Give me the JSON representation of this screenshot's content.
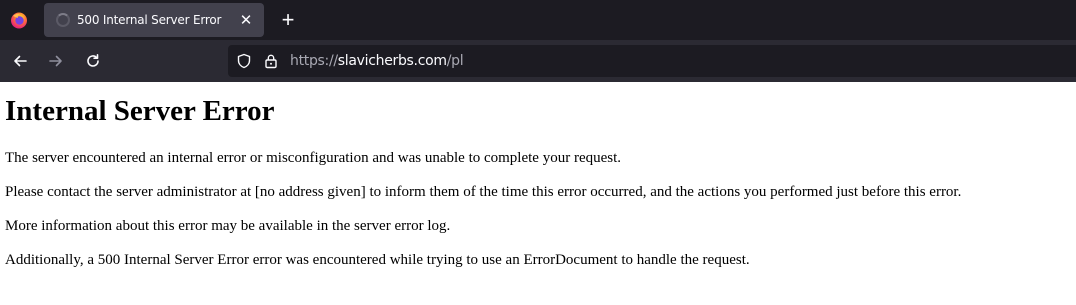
{
  "browser": {
    "tab": {
      "title": "500 Internal Server Error",
      "state": "loading"
    },
    "url": {
      "scheme": "https://",
      "host": "slavicherbs.com",
      "path": "/pl"
    },
    "icons": {
      "menu": "firefox-logo-icon",
      "close": "close-icon",
      "new_tab": "plus-icon",
      "back": "back-arrow-icon",
      "forward": "forward-arrow-icon",
      "reload": "reload-icon",
      "tracking": "shield-icon",
      "security": "lock-icon"
    },
    "colors": {
      "tabstrip": "#1c1b22",
      "active_tab": "#42414d",
      "toolbar": "#2b2a33",
      "urlbar": "#1c1b22"
    }
  },
  "page": {
    "heading": "Internal Server Error",
    "paragraphs": [
      "The server encountered an internal error or misconfiguration and was unable to complete your request.",
      "Please contact the server administrator at [no address given] to inform them of the time this error occurred, and the actions you performed just before this error.",
      "More information about this error may be available in the server error log.",
      "Additionally, a 500 Internal Server Error error was encountered while trying to use an ErrorDocument to handle the request."
    ]
  }
}
